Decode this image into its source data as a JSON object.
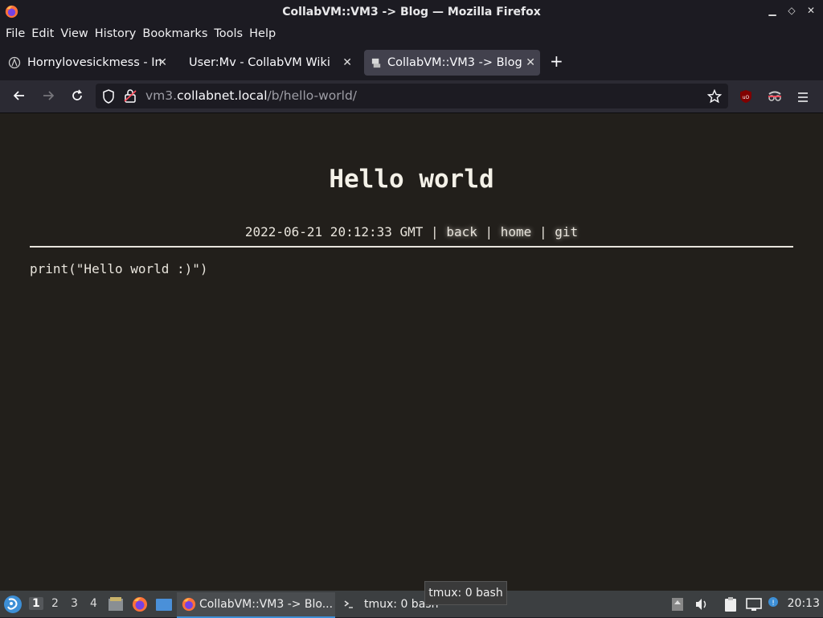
{
  "window": {
    "title": "CollabVM::VM3 -> Blog — Mozilla Firefox"
  },
  "menu": [
    "File",
    "Edit",
    "View",
    "History",
    "Bookmarks",
    "Tools",
    "Help"
  ],
  "tabs": [
    {
      "label": "Hornylovesickmess - In",
      "active": false
    },
    {
      "label": "User:Mv - CollabVM Wiki",
      "active": false
    },
    {
      "label": "CollabVM::VM3 -> Blog",
      "active": true
    }
  ],
  "url": {
    "host_prefix": "vm3.",
    "host": "collabnet.local",
    "path": "/b/hello-world/"
  },
  "page": {
    "title": "Hello world",
    "date": "2022-06-21 20:12:33 GMT",
    "sep": "|",
    "links": [
      "back",
      "home",
      "git"
    ],
    "code": "print(\"Hello world :)\")"
  },
  "taskbar": {
    "workspaces": [
      "1",
      "2",
      "3",
      "4"
    ],
    "tasks": [
      {
        "label": "CollabVM::VM3 -> Blo...",
        "active": true
      },
      {
        "label": "tmux: 0 bash",
        "active": false
      }
    ],
    "tooltip": "tmux: 0 bash",
    "clock": "20:13"
  }
}
